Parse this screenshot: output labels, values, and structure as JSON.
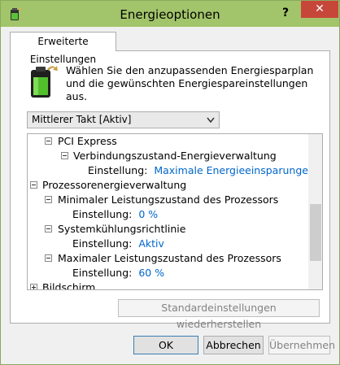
{
  "window": {
    "title": "Energieoptionen",
    "help_label": "?",
    "close_label": "✕"
  },
  "tab": {
    "label": "Erweiterte Einstellungen"
  },
  "description": "Wählen Sie den anzupassenden Energiesparplan und die gewünschten Energiespareinstellungen aus.",
  "plan_select": {
    "value": "Mittlerer Takt [Aktiv]"
  },
  "tree": {
    "pci_express": "PCI Express",
    "link_state": "Verbindungszustand-Energieverwaltung",
    "link_state_setting_label": "Einstellung:",
    "link_state_setting_value": "Maximale Energieeinsparungen",
    "processor": "Prozessorenergieverwaltung",
    "min_state": "Minimaler Leistungszustand des Prozessors",
    "min_state_setting_label": "Einstellung:",
    "min_state_setting_value": "0 %",
    "cooling": "Systemkühlungsrichtlinie",
    "cooling_setting_label": "Einstellung:",
    "cooling_setting_value": "Aktiv",
    "max_state": "Maximaler Leistungszustand des Prozessors",
    "max_state_setting_label": "Einstellung:",
    "max_state_setting_value": "60 %",
    "display": "Bildschirm"
  },
  "buttons": {
    "restore": "Standardeinstellungen wiederherstellen",
    "ok": "OK",
    "cancel": "Abbrechen",
    "apply": "Übernehmen"
  },
  "colors": {
    "titlebar": "#a2c46a",
    "close": "#c7463a",
    "value_link": "#0066cc"
  },
  "icons": {
    "app": "battery-plug-icon",
    "header": "battery-plug-icon",
    "expander_open": "minus-box-icon",
    "expander_closed": "plus-box-icon",
    "select_arrow": "chevron-down-icon"
  }
}
